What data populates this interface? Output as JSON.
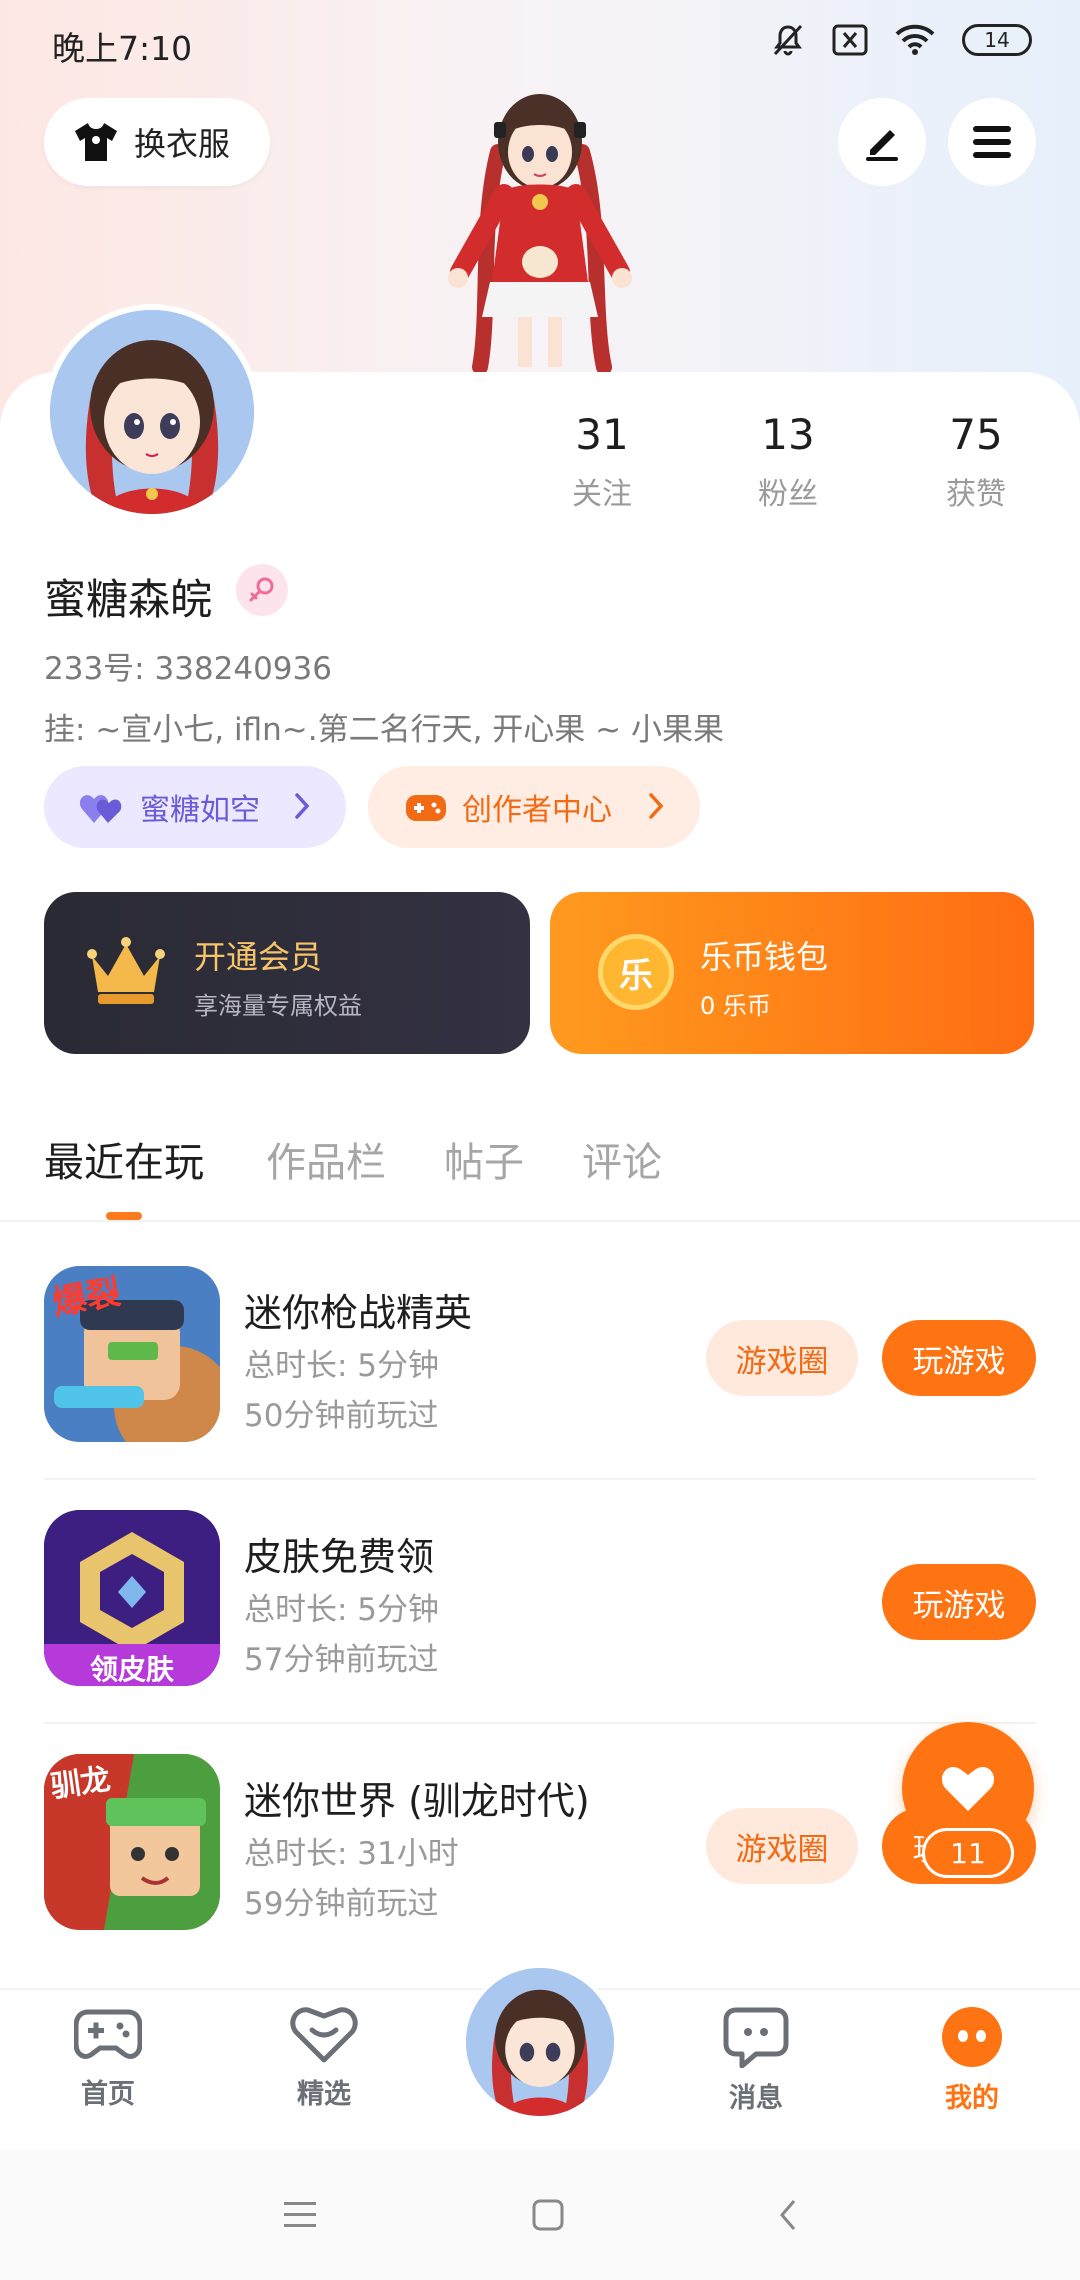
{
  "status_bar": {
    "time": "晚上7:10",
    "battery": "14"
  },
  "header": {
    "dress_button_label": "换衣服"
  },
  "profile": {
    "stats": [
      {
        "value": "31",
        "label": "关注"
      },
      {
        "value": "13",
        "label": "粉丝"
      },
      {
        "value": "75",
        "label": "获赞"
      }
    ],
    "nickname": "蜜糖森皖",
    "uid": "233号: 338240936",
    "hang": "挂: ~宣小七, ifln~.第二名行天, 开心果 ~ 小果果",
    "tags": [
      {
        "label": "蜜糖如空"
      },
      {
        "label": "创作者中心"
      }
    ]
  },
  "cards": {
    "vip": {
      "title": "开通会员",
      "subtitle": "享海量专属权益"
    },
    "wallet": {
      "title": "乐币钱包",
      "subtitle": "0 乐币",
      "coin_glyph": "乐"
    }
  },
  "tabs": [
    "最近在玩",
    "作品栏",
    "帖子",
    "评论"
  ],
  "games": [
    {
      "name": "迷你枪战精英",
      "duration": "总时长: 5分钟",
      "last_played": "50分钟前玩过",
      "icon_text": "爆裂",
      "circle_label": "游戏圈",
      "play_label": "玩游戏"
    },
    {
      "name": "皮肤免费领",
      "duration": "总时长: 5分钟",
      "last_played": "57分钟前玩过",
      "icon_text": "领皮肤",
      "play_label": "玩游戏"
    },
    {
      "name": "迷你世界 (驯龙时代)",
      "duration": "总时长: 31小时",
      "last_played": "59分钟前玩过",
      "icon_text": "驯龙",
      "circle_label": "游戏圈",
      "play_label": "玩游戏"
    }
  ],
  "fab": {
    "count": "11"
  },
  "bottom_nav": [
    {
      "label": "首页"
    },
    {
      "label": "精选"
    },
    {
      "label": "消息"
    },
    {
      "label": "我的"
    }
  ],
  "colors": {
    "accent": "#ff7412",
    "purple": "#6a5cd6",
    "vip_dark": "#2a2a34",
    "gold": "#f7c46a"
  }
}
